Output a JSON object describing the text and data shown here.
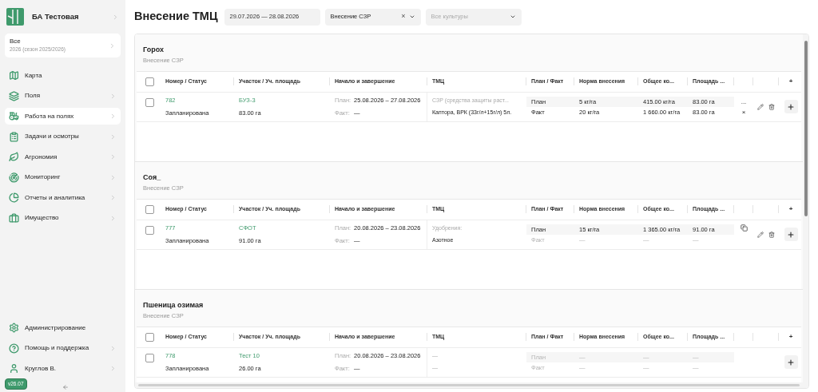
{
  "sidebar": {
    "org": "БА Тестовая",
    "season": {
      "title": "Все",
      "subtitle": "2026 (сезон 2025/2026)"
    },
    "nav": [
      {
        "label": "Карта",
        "selected": false,
        "chevron": false
      },
      {
        "label": "Поля",
        "selected": false,
        "chevron": true
      },
      {
        "label": "Работа на полях",
        "selected": true,
        "chevron": true
      },
      {
        "label": "Задачи и осмотры",
        "selected": false,
        "chevron": true
      },
      {
        "label": "Агрономия",
        "selected": false,
        "chevron": true
      },
      {
        "label": "Мониторинг",
        "selected": false,
        "chevron": true
      },
      {
        "label": "Отчеты и аналитика",
        "selected": false,
        "chevron": true
      },
      {
        "label": "Имущество",
        "selected": false,
        "chevron": true
      }
    ],
    "bottom": [
      {
        "label": "Администрирование",
        "chevron": false
      },
      {
        "label": "Помощь и поддержка",
        "chevron": true
      },
      {
        "label": "Круглов В.",
        "chevron": true
      }
    ],
    "version": "v26.07"
  },
  "header": {
    "title": "Внесение ТМЦ",
    "date_range": "29.07.2026 — 28.08.2026",
    "type_filter": {
      "value": "Внесение СЗР",
      "clear": "×"
    },
    "crop_filter": {
      "placeholder": "Все культуры"
    }
  },
  "groups": [
    {
      "title": "Горох",
      "subtitle": "Внесение СЗР",
      "select_all": {
        "checked": false
      },
      "columns": [
        "Номер / Статус",
        "Участок / Уч. площадь",
        "Начало и завершение",
        "ТМЦ",
        "План / Факт",
        "Норма внесения",
        "Общее ко...",
        "Площадь ..."
      ],
      "add_column": "+",
      "rows": [
        {
          "number": "782",
          "status": "Запланирована",
          "plot": "БУЗ-3",
          "area": "83.00 га",
          "checked": false,
          "copyable": false,
          "editable": true,
          "dates": [
            {
              "label": "План:",
              "value": "25.08.2026 – 27.08.2026"
            },
            {
              "label": "Факт:",
              "value": "—"
            }
          ],
          "tmc": [
            {
              "text": "СЗР (средства защиты раст...",
              "muted": true
            },
            {
              "text": "Каптора, ВРК (33г/л+15г/л) 5л.",
              "muted": false
            }
          ],
          "lines": [
            {
              "label": "План",
              "rate": "5 кг/га",
              "total": "415.00 кг/га",
              "area": "83.00 га",
              "extra": "...",
              "muted": false
            },
            {
              "label": "Факт",
              "rate": "20 кг/га",
              "total": "1 660.00 кг/га",
              "area": "83.00 га",
              "extra": "×",
              "muted": false
            }
          ]
        }
      ]
    },
    {
      "title": "Соя_",
      "subtitle": "Внесение СЗР",
      "select_all": {
        "checked": false
      },
      "columns": [
        "Номер / Статус",
        "Участок / Уч. площадь",
        "Начало и завершение",
        "ТМЦ",
        "План / Факт",
        "Норма внесения",
        "Общее ко...",
        "Площадь ..."
      ],
      "add_column": "+",
      "rows": [
        {
          "number": "777",
          "status": "Запланирована",
          "plot": "СФОТ",
          "area": "91.00 га",
          "checked": false,
          "copyable": true,
          "editable": true,
          "dates": [
            {
              "label": "План:",
              "value": "20.08.2026 – 23.08.2026"
            },
            {
              "label": "Факт:",
              "value": "—"
            }
          ],
          "tmc": [
            {
              "text": "Удобрения:",
              "muted": true
            },
            {
              "text": "Азотное",
              "muted": false
            }
          ],
          "lines": [
            {
              "label": "План",
              "rate": "15 кг/га",
              "total": "1 365.00 кг/га",
              "area": "91.00 га",
              "muted": false
            },
            {
              "label": "Факт",
              "rate": "—",
              "total": "—",
              "area": "—",
              "muted": true
            }
          ]
        }
      ]
    },
    {
      "title": "Пшеница озимая",
      "subtitle": "Внесение СЗР",
      "select_all": {
        "checked": false
      },
      "columns": [
        "Номер / Статус",
        "Участок / Уч. площадь",
        "Начало и завершение",
        "ТМЦ",
        "План / Факт",
        "Норма внесения",
        "Общее ко...",
        "Площадь ..."
      ],
      "add_column": "+",
      "rows": [
        {
          "number": "778",
          "status": "Запланирована",
          "plot": "Тест 10",
          "area": "26.00 га",
          "checked": false,
          "copyable": false,
          "editable": false,
          "dates": [
            {
              "label": "План:",
              "value": "20.08.2026 – 23.08.2026"
            },
            {
              "label": "Факт:",
              "value": "—"
            }
          ],
          "tmc": [
            {
              "text": "—",
              "muted": true
            },
            {
              "text": "—",
              "muted": true
            }
          ],
          "lines": [
            {
              "label": "План",
              "rate": "—",
              "total": "—",
              "area": "—",
              "muted": true
            },
            {
              "label": "Факт",
              "rate": "—",
              "total": "—",
              "area": "—",
              "muted": true
            }
          ]
        }
      ]
    }
  ]
}
